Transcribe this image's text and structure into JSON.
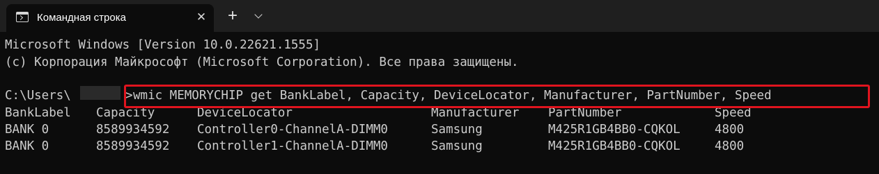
{
  "tab": {
    "icon": "terminal-icon",
    "title": "Командная строка",
    "close_icon": "close-icon",
    "new_tab_icon": "plus-icon",
    "dropdown_icon": "chevron-down-icon"
  },
  "console": {
    "header_line1": "Microsoft Windows [Version 10.0.22621.1555]",
    "header_line2": "(c) Корпорация Майкрософт (Microsoft Corporation). Все права защищены.",
    "prompt_prefix": "C:\\Users\\",
    "prompt_suffix": ">",
    "command": "wmic MEMORYCHIP get BankLabel, Capacity, DeviceLocator, Manufacturer, PartNumber, Speed",
    "table": {
      "headers": [
        "BankLabel",
        "Capacity",
        "DeviceLocator",
        "Manufacturer",
        "PartNumber",
        "Speed"
      ],
      "rows": [
        [
          "BANK 0",
          "8589934592",
          "Controller0-ChannelA-DIMM0",
          "Samsung",
          "M425R1GB4BB0-CQKOL",
          "4800"
        ],
        [
          "BANK 0",
          "8589934592",
          "Controller1-ChannelA-DIMM0",
          "Samsung",
          "M425R1GB4BB0-CQKOL",
          "4800"
        ]
      ]
    }
  },
  "colors": {
    "background": "#0c0c0c",
    "tabstrip": "#1f1f1f",
    "text": "#cccccc",
    "highlight": "#e0141e"
  }
}
